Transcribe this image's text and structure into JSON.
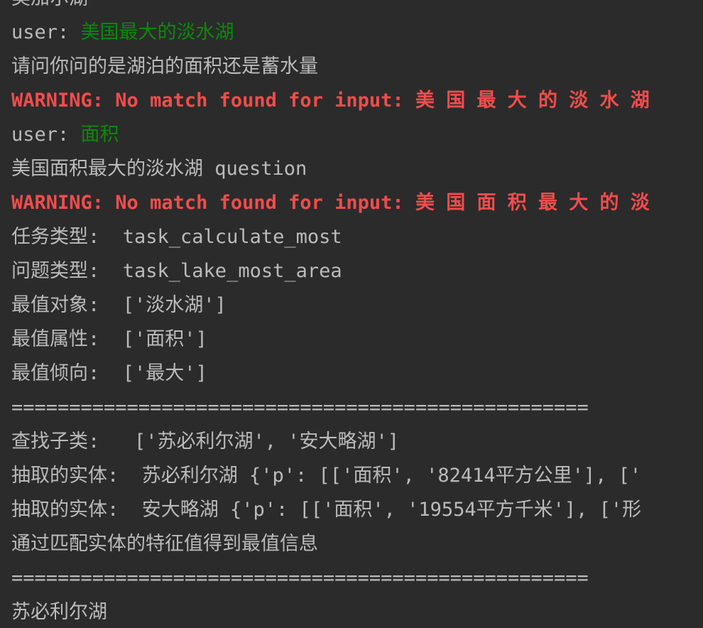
{
  "colors": {
    "background": "#2b2b2b",
    "text": "#bbbbbb",
    "user_input": "#0a8a0a",
    "warning": "#f14c4c"
  },
  "console": {
    "lines": [
      {
        "kind": "plain",
        "text": "美加尔湖"
      },
      {
        "kind": "user",
        "prompt": "user: ",
        "text": "美国最大的淡水湖"
      },
      {
        "kind": "plain",
        "text": "请问你问的是湖泊的面积还是蓄水量"
      },
      {
        "kind": "warning",
        "text": "WARNING: No match found for input: 美 国 最 大 的 淡 水 湖"
      },
      {
        "kind": "user",
        "prompt": "user: ",
        "text": "面积"
      },
      {
        "kind": "plain",
        "text": "美国面积最大的淡水湖 question"
      },
      {
        "kind": "warning",
        "text": "WARNING: No match found for input: 美 国 面 积 最 大 的 淡"
      },
      {
        "kind": "plain",
        "text": "任务类型:  task_calculate_most"
      },
      {
        "kind": "plain",
        "text": "问题类型:  task_lake_most_area"
      },
      {
        "kind": "plain",
        "text": "最值对象:  ['淡水湖']"
      },
      {
        "kind": "plain",
        "text": "最值属性:  ['面积']"
      },
      {
        "kind": "plain",
        "text": "最值倾向:  ['最大']"
      },
      {
        "kind": "plain",
        "text": "=================================================="
      },
      {
        "kind": "plain",
        "text": "查找子类:   ['苏必利尔湖', '安大略湖']"
      },
      {
        "kind": "plain",
        "text": "抽取的实体:  苏必利尔湖 {'p': [['面积', '82414平方公里'], ['"
      },
      {
        "kind": "plain",
        "text": "抽取的实体:  安大略湖 {'p': [['面积', '19554平方千米'], ['形"
      },
      {
        "kind": "plain",
        "text": "通过匹配实体的特征值得到最值信息"
      },
      {
        "kind": "plain",
        "text": "=================================================="
      },
      {
        "kind": "plain",
        "text": "苏必利尔湖"
      }
    ]
  }
}
